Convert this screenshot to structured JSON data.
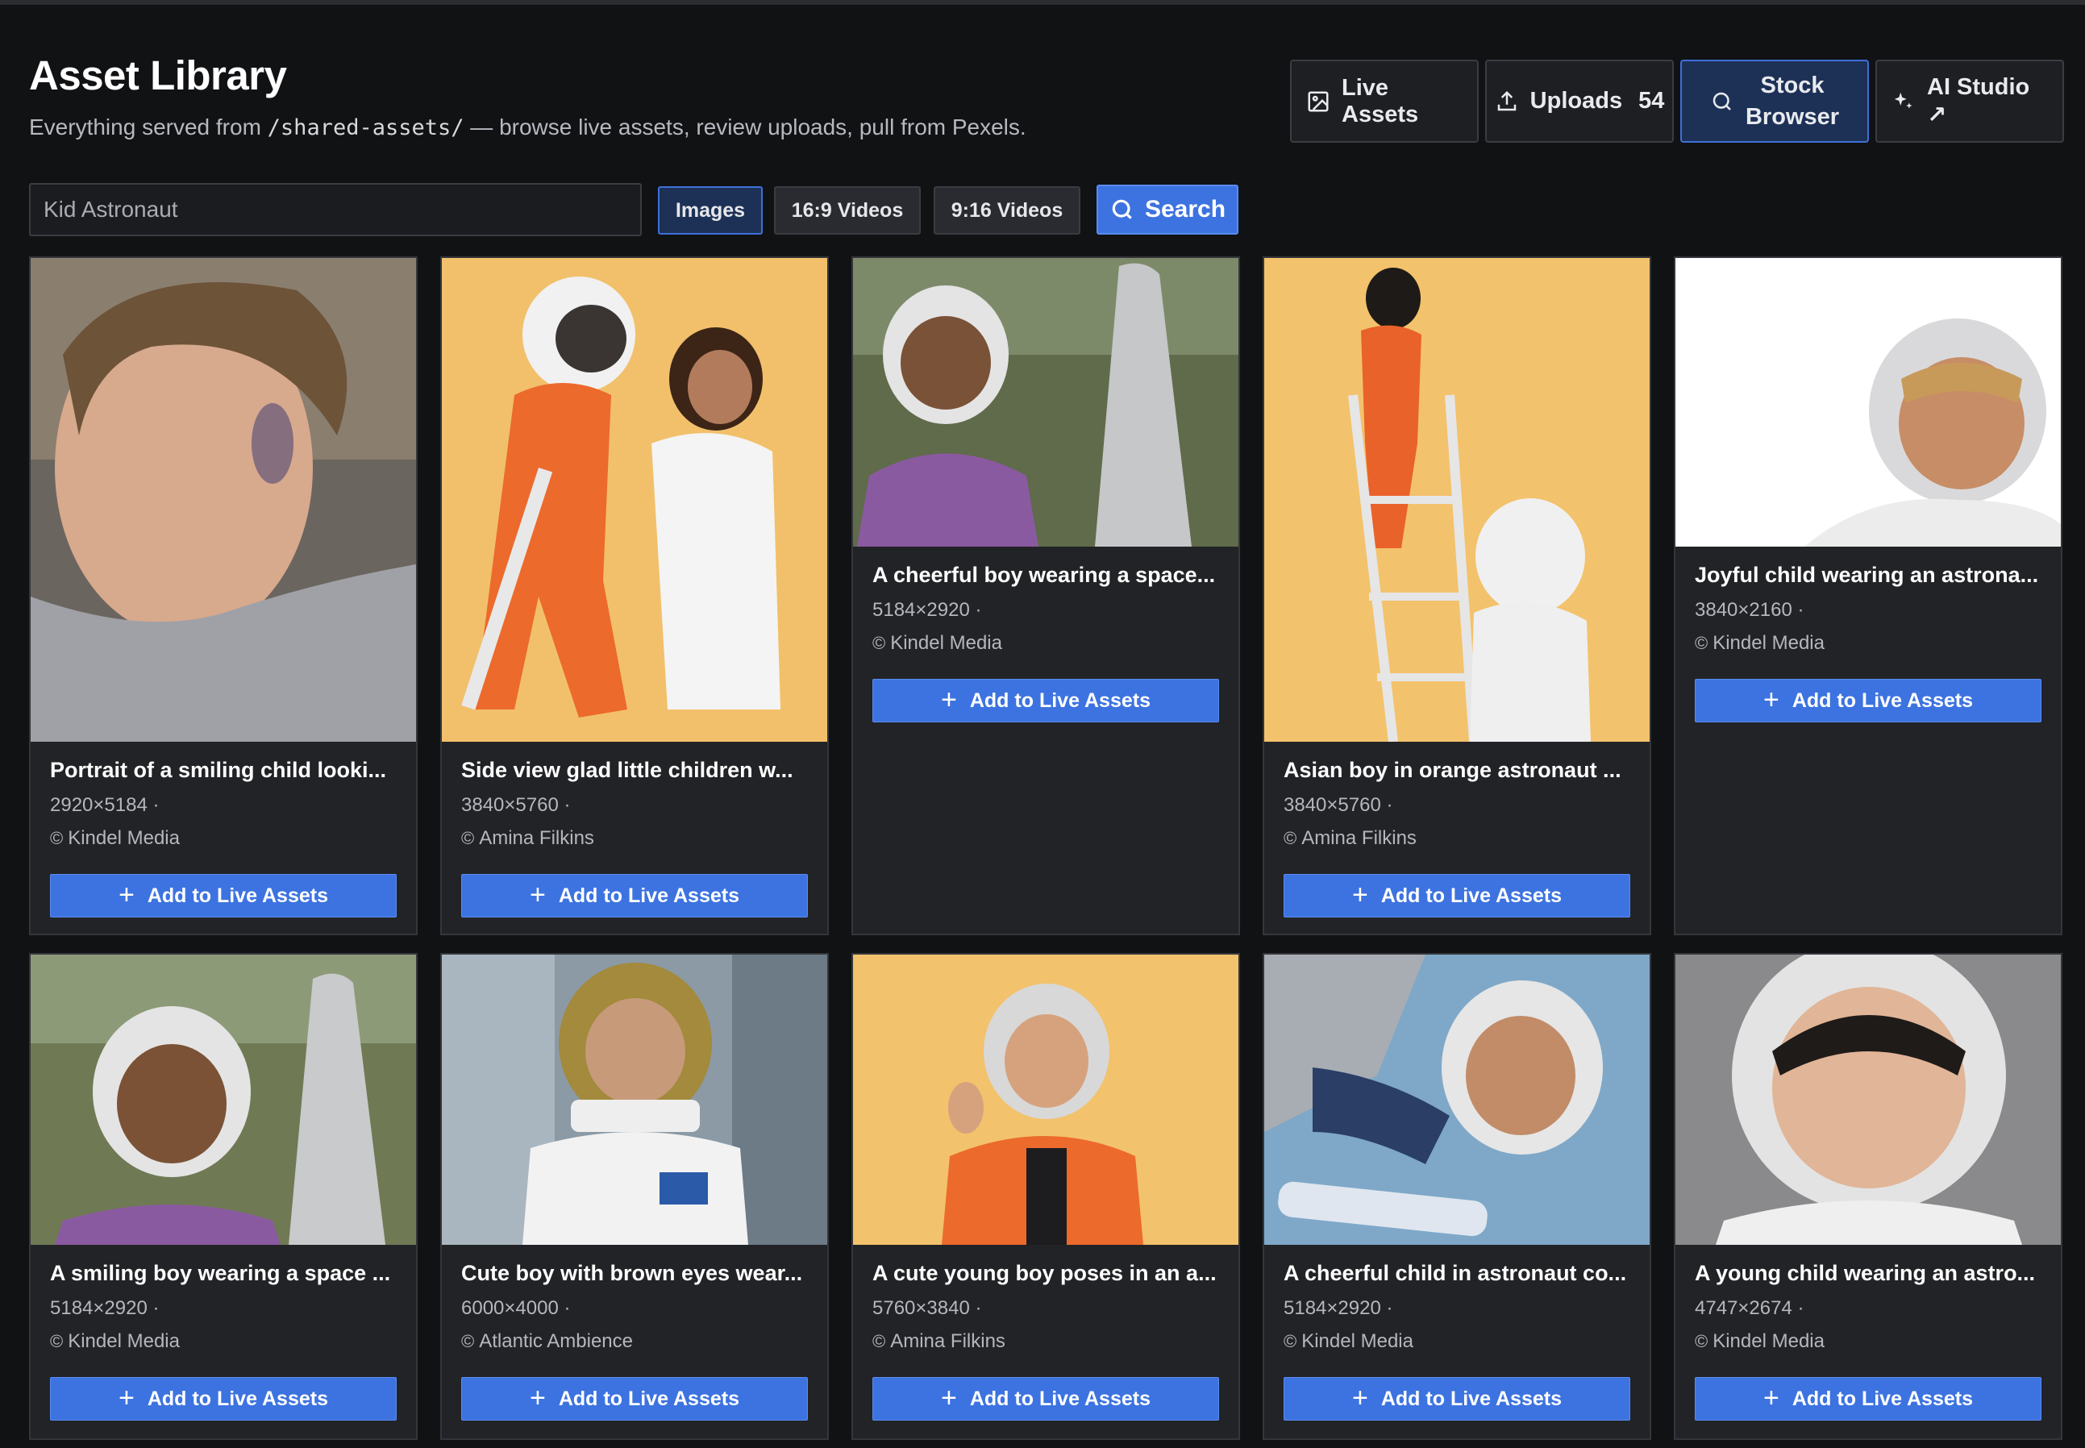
{
  "header": {
    "title": "Asset Library",
    "subtitle_pre": "Everything served from ",
    "subtitle_path": "/shared-assets/",
    "subtitle_post": " — browse live assets, review uploads, pull from Pexels."
  },
  "nav": {
    "live_assets": "Live Assets",
    "uploads": "Uploads",
    "uploads_count": "54",
    "stock_line1": "Stock",
    "stock_line2": "Browser",
    "ai_studio": "AI Studio ↗"
  },
  "search": {
    "value": "Kid Astronaut",
    "filters": [
      "Images",
      "16:9 Videos",
      "9:16 Videos"
    ],
    "active_filter": "Images",
    "button": "Search"
  },
  "add_label": "Add to Live Assets",
  "cards": [
    {
      "title": "Portrait of a smiling child looki...",
      "dims": "2920×5184 ·",
      "author": "Kindel Media"
    },
    {
      "title": "Side view glad little children w...",
      "dims": "3840×5760 ·",
      "author": "Amina Filkins"
    },
    {
      "title": "A cheerful boy wearing a space...",
      "dims": "5184×2920 ·",
      "author": "Kindel Media"
    },
    {
      "title": "Asian boy in orange astronaut ...",
      "dims": "3840×5760 ·",
      "author": "Amina Filkins"
    },
    {
      "title": "Joyful child wearing an astrona...",
      "dims": "3840×2160 ·",
      "author": "Kindel Media"
    },
    {
      "title": "A smiling boy wearing a space ...",
      "dims": "5184×2920 ·",
      "author": "Kindel Media"
    },
    {
      "title": "Cute boy with brown eyes wear...",
      "dims": "6000×4000 ·",
      "author": "Atlantic Ambience"
    },
    {
      "title": "A cute young boy poses in an a...",
      "dims": "5760×3840 ·",
      "author": "Amina Filkins"
    },
    {
      "title": "A cheerful child in astronaut co...",
      "dims": "5184×2920 ·",
      "author": "Kindel Media"
    },
    {
      "title": "A young child wearing an astro...",
      "dims": "4747×2674 ·",
      "author": "Kindel Media"
    }
  ],
  "colors": {
    "accent": "#3d73e0",
    "active_bg": "#1d3157",
    "background": "#111214",
    "card": "#222326"
  }
}
